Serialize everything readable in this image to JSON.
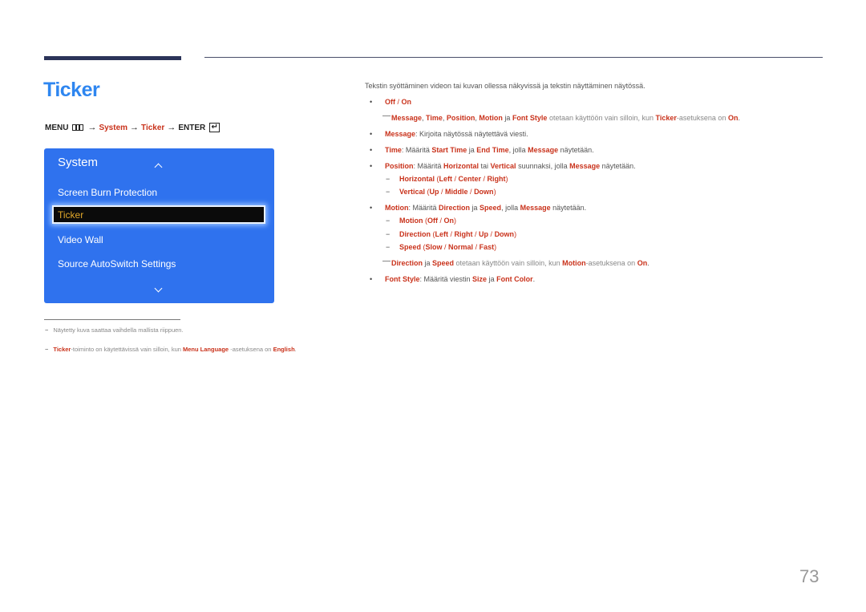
{
  "title": "Ticker",
  "menu_path": {
    "menu": "MENU",
    "arrow": "→",
    "system": "System",
    "ticker": "Ticker",
    "enter": "ENTER",
    "enter_glyph": "↵"
  },
  "osd": {
    "title": "System",
    "items": [
      "Screen Burn Protection",
      "Ticker",
      "Video Wall",
      "Source AutoSwitch Settings"
    ],
    "selected": "Ticker"
  },
  "footnotes": {
    "dash": "−",
    "note1": "Näytetty kuva saattaa vaihdella mallista riippuen.",
    "note2": {
      "ticker": "Ticker",
      "t1": "-toiminto on käytettävissä vain silloin, kun ",
      "menu_language": "Menu Language",
      "t2": " -asetuksena on ",
      "english": "English",
      "t3": "."
    }
  },
  "content": {
    "intro": "Tekstin syöttäminen videon tai kuvan ollessa näkyvissä ja tekstin näyttäminen näytössä.",
    "bullet": "•",
    "dash": "−",
    "off_on": {
      "off": "Off",
      "sep": " / ",
      "on": "On"
    },
    "note1": {
      "message": "Message",
      "c1": ", ",
      "time": "Time",
      "c2": ", ",
      "position": "Position",
      "c3": ", ",
      "motion": "Motion",
      "ja": " ja ",
      "font_style": "Font Style",
      "t1": " otetaan käyttöön vain silloin, kun ",
      "ticker": "Ticker",
      "t2": "-asetuksena on ",
      "on": "On",
      "t3": "."
    },
    "message": {
      "label": "Message",
      "text": ": Kirjoita näytössä näytettävä viesti."
    },
    "time": {
      "label": "Time",
      "t1": ": Määritä ",
      "start": "Start Time",
      "ja": " ja ",
      "end": "End Time",
      "t2": ", jolla ",
      "message": "Message",
      "t3": " näytetään."
    },
    "position": {
      "label": "Position",
      "t1": ": Määritä ",
      "horizontal": "Horizontal",
      "tai": " tai ",
      "vertical": "Vertical",
      "t2": " suunnaksi, jolla ",
      "message": "Message",
      "t3": " näytetään."
    },
    "horizontal_opts": {
      "label": "Horizontal",
      "open": " (",
      "left": "Left",
      "s1": " / ",
      "center": "Center",
      "s2": " / ",
      "right": "Right",
      "close": ")"
    },
    "vertical_opts": {
      "label": "Vertical",
      "open": " (",
      "up": "Up",
      "s1": " / ",
      "middle": "Middle",
      "s2": " / ",
      "down": "Down",
      "close": ")"
    },
    "motion": {
      "label": "Motion",
      "t1": ": Määritä ",
      "direction": "Direction",
      "ja": " ja ",
      "speed": "Speed",
      "t2": ", jolla ",
      "message": "Message",
      "t3": " näytetään."
    },
    "motion_opts": {
      "label": "Motion",
      "open": " (",
      "off": "Off",
      "s1": " / ",
      "on": "On",
      "close": ")"
    },
    "direction_opts": {
      "label": "Direction",
      "open": " (",
      "left": "Left",
      "s1": " / ",
      "right": "Right",
      "s2": " / ",
      "up": "Up",
      "s3": " / ",
      "down": "Down",
      "close": ")"
    },
    "speed_opts": {
      "label": "Speed",
      "open": " (",
      "slow": "Slow",
      "s1": " / ",
      "normal": "Normal",
      "s2": " / ",
      "fast": "Fast",
      "close": ")"
    },
    "note2": {
      "direction": "Direction",
      "ja": " ja ",
      "speed": "Speed",
      "t1": " otetaan käyttöön vain silloin, kun ",
      "motion": "Motion",
      "t2": "-asetuksena on ",
      "on": "On",
      "t3": "."
    },
    "font_style": {
      "label": "Font Style",
      "t1": ": Määritä viestin ",
      "size": "Size",
      "ja": " ja ",
      "color": "Font Color",
      "t2": "."
    }
  },
  "page_number": "73"
}
